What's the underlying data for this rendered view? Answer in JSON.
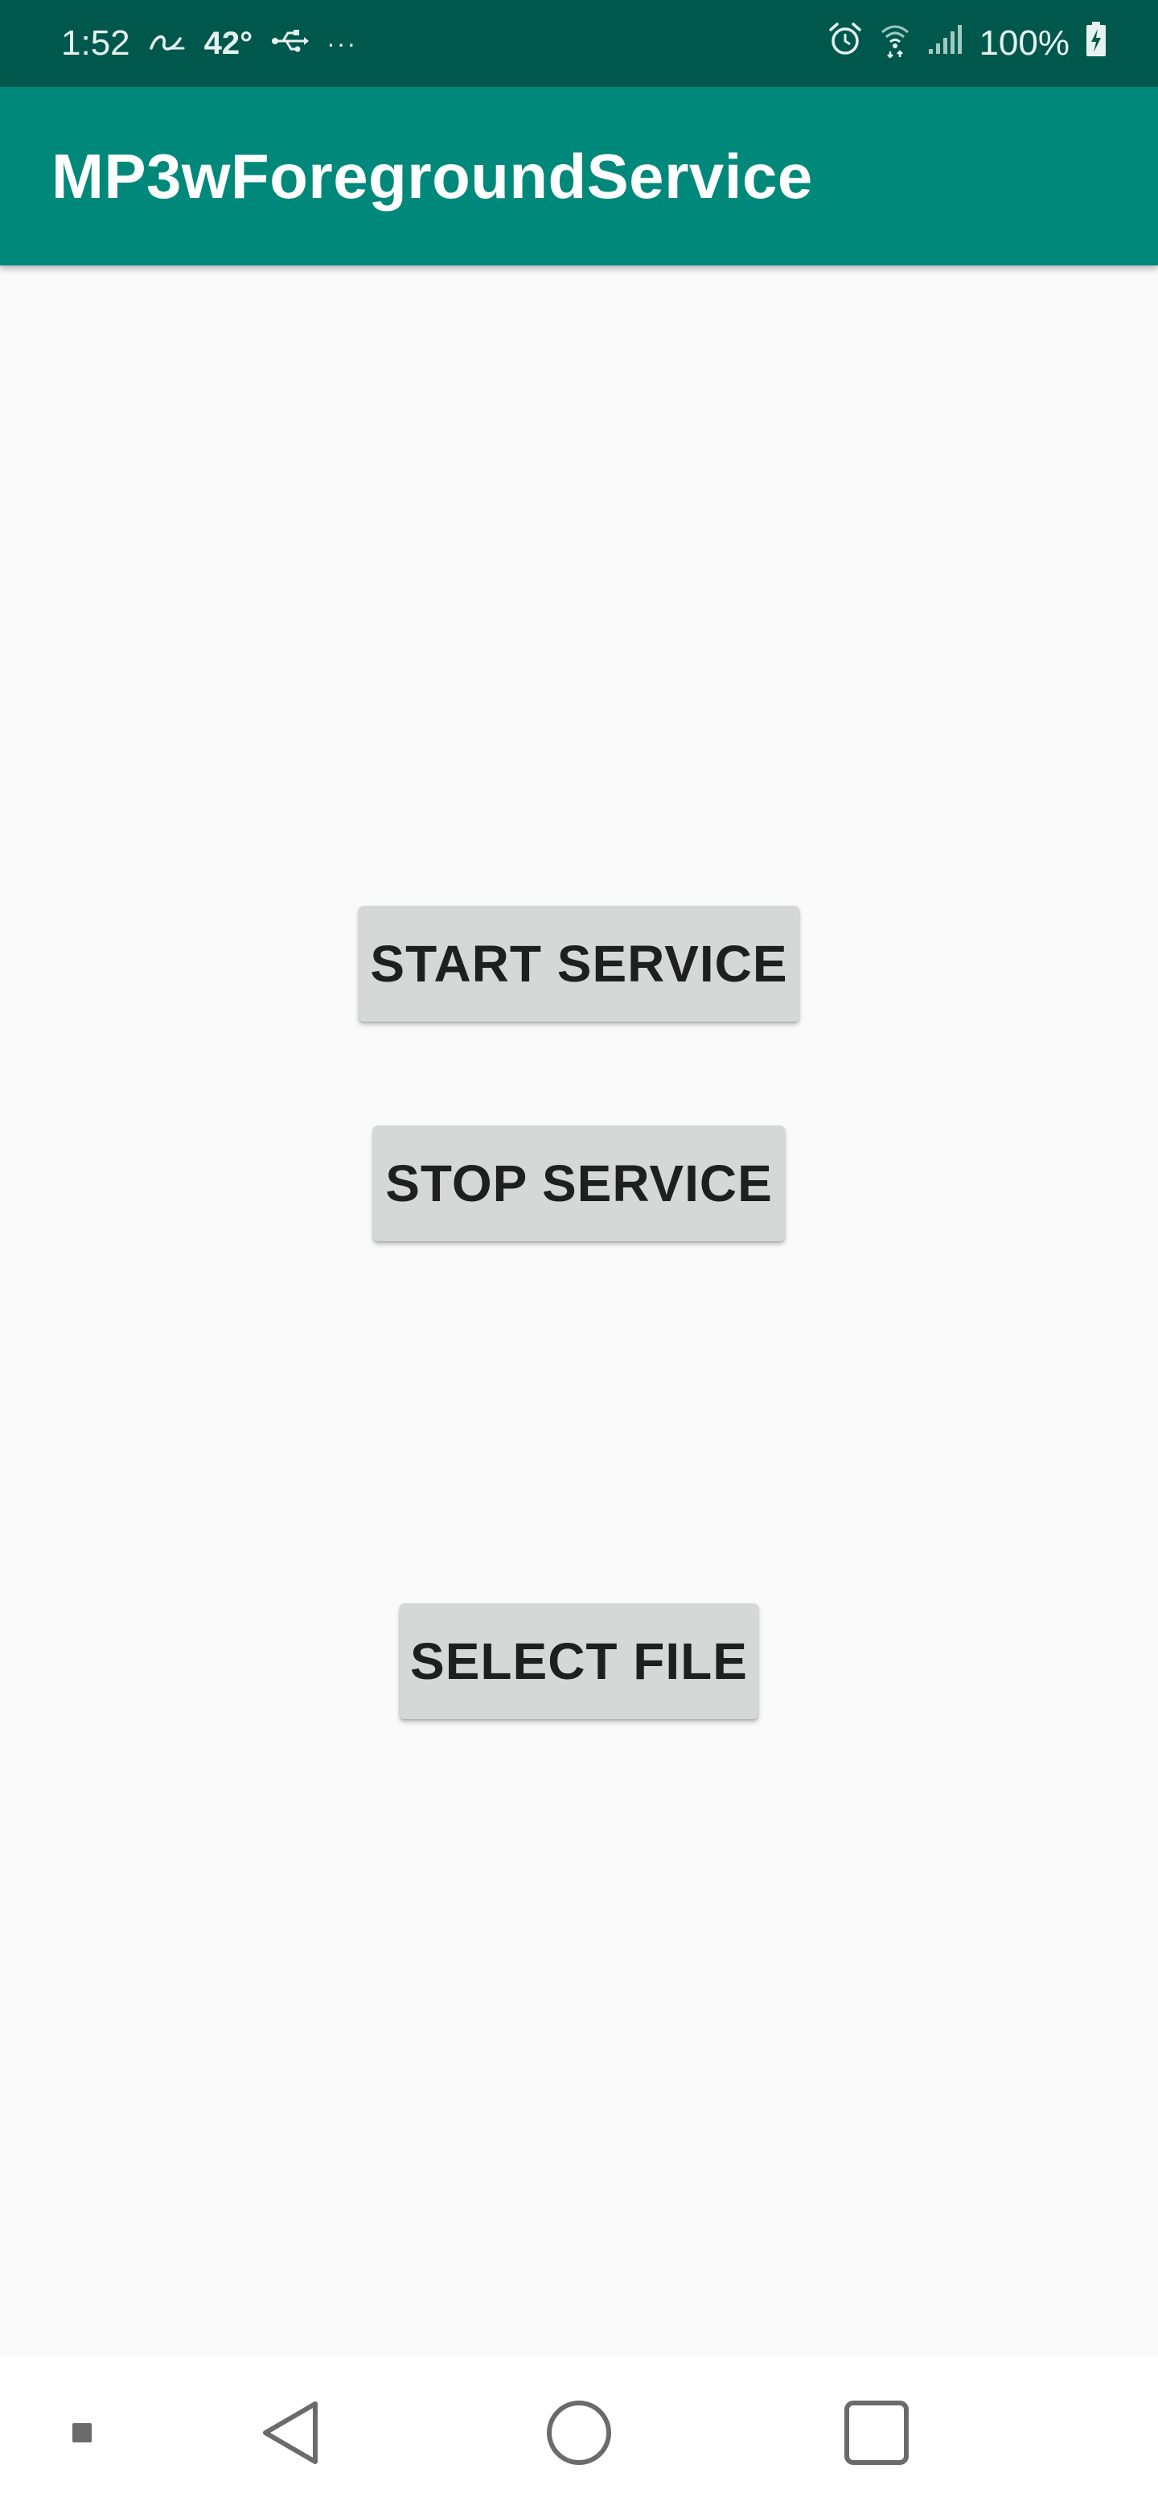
{
  "status_bar": {
    "time": "1:52",
    "temperature": "42°",
    "more": "···",
    "battery": "100%",
    "icons": [
      "link-icon",
      "usb-icon",
      "alarm-icon",
      "wifi-icon",
      "signal-icon",
      "battery-charging-icon"
    ]
  },
  "app_bar": {
    "title": "MP3wForegroundService",
    "color": "#00897b"
  },
  "buttons": {
    "start": "START SERVICE",
    "stop": "STOP SERVICE",
    "select": "SELECT FILE"
  },
  "nav_bar": {
    "icons": [
      "nav-dot-icon",
      "back-icon",
      "home-icon",
      "recent-apps-icon"
    ]
  },
  "colors": {
    "status_bar": "#00584c",
    "app_bar": "#00897b",
    "background": "#fafafa",
    "button": "#d6d7d7"
  }
}
